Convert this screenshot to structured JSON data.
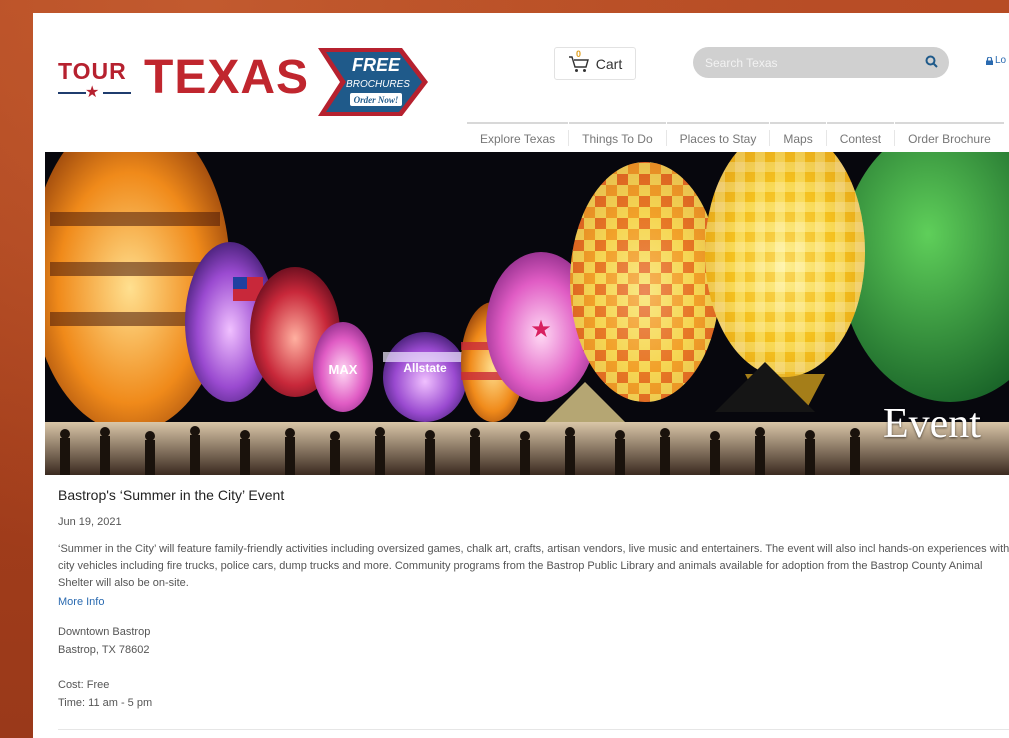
{
  "header": {
    "logo": {
      "tour": "TOUR",
      "texas": "TEXAS",
      "badge_free": "FREE",
      "badge_brochures": "BROCHURES",
      "badge_order": "Order Now!"
    },
    "cart_label": "Cart",
    "cart_count": "0",
    "search_placeholder": "Search Texas",
    "login_label": "Lo"
  },
  "nav": {
    "items": [
      "Explore Texas",
      "Things To Do",
      "Places to Stay",
      "Maps",
      "Contest",
      "Order Brochure"
    ]
  },
  "banner": {
    "title": "Event",
    "balloon_text": [
      "Allstate",
      "MAX"
    ]
  },
  "event": {
    "title": "Bastrop's ‘Summer in the City’ Event",
    "date": "Jun 19, 2021",
    "description": "‘Summer in the City’ will feature family-friendly activities including oversized games, chalk art, crafts, artisan vendors, live music and entertainers. The event will also incl hands-on experiences with city vehicles including fire trucks, police cars, dump trucks and more. Community programs from the Bastrop Public Library and animals available for adoption from the Bastrop County Animal Shelter will also be on-site.",
    "more_info": "More Info",
    "address_line1": "Downtown Bastrop",
    "address_line2": "Bastrop, TX 78602",
    "cost": "Cost: Free",
    "time": "Time: 11 am - 5 pm"
  },
  "colors": {
    "brand_red": "#c0262e",
    "brand_blue": "#1f5a8a",
    "link": "#2a6ab0",
    "background": "#a8401f"
  }
}
